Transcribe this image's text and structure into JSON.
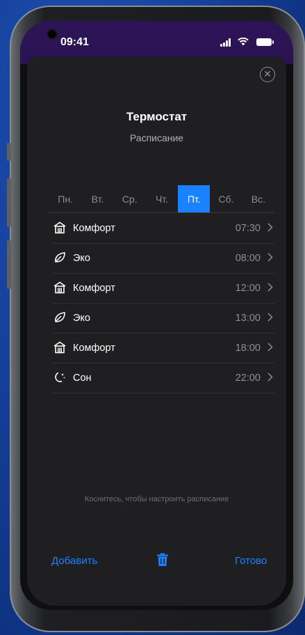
{
  "status_bar": {
    "time": "09:41"
  },
  "header": {
    "title": "Термостат",
    "subtitle": "Расписание",
    "close_icon": "close-circle-icon"
  },
  "days": [
    {
      "label": "Пн.",
      "selected": false
    },
    {
      "label": "Вт.",
      "selected": false
    },
    {
      "label": "Ср.",
      "selected": false
    },
    {
      "label": "Чт.",
      "selected": false
    },
    {
      "label": "Пт.",
      "selected": true
    },
    {
      "label": "Сб.",
      "selected": false
    },
    {
      "label": "Вс.",
      "selected": false
    }
  ],
  "schedule": [
    {
      "mode": "Комфорт",
      "time": "07:30",
      "icon": "home-icon"
    },
    {
      "mode": "Эко",
      "time": "08:00",
      "icon": "leaf-icon"
    },
    {
      "mode": "Комфорт",
      "time": "12:00",
      "icon": "home-icon"
    },
    {
      "mode": "Эко",
      "time": "13:00",
      "icon": "leaf-icon"
    },
    {
      "mode": "Комфорт",
      "time": "18:00",
      "icon": "home-icon"
    },
    {
      "mode": "Сон",
      "time": "22:00",
      "icon": "moon-icon"
    }
  ],
  "hint": "Коснитесь, чтобы настроить расписание",
  "footer": {
    "add_label": "Добавить",
    "done_label": "Готово",
    "delete_icon": "trash-icon"
  },
  "colors": {
    "accent": "#1a82ff",
    "sheet": "#1f1f22",
    "status_bar": "#2d1458"
  }
}
